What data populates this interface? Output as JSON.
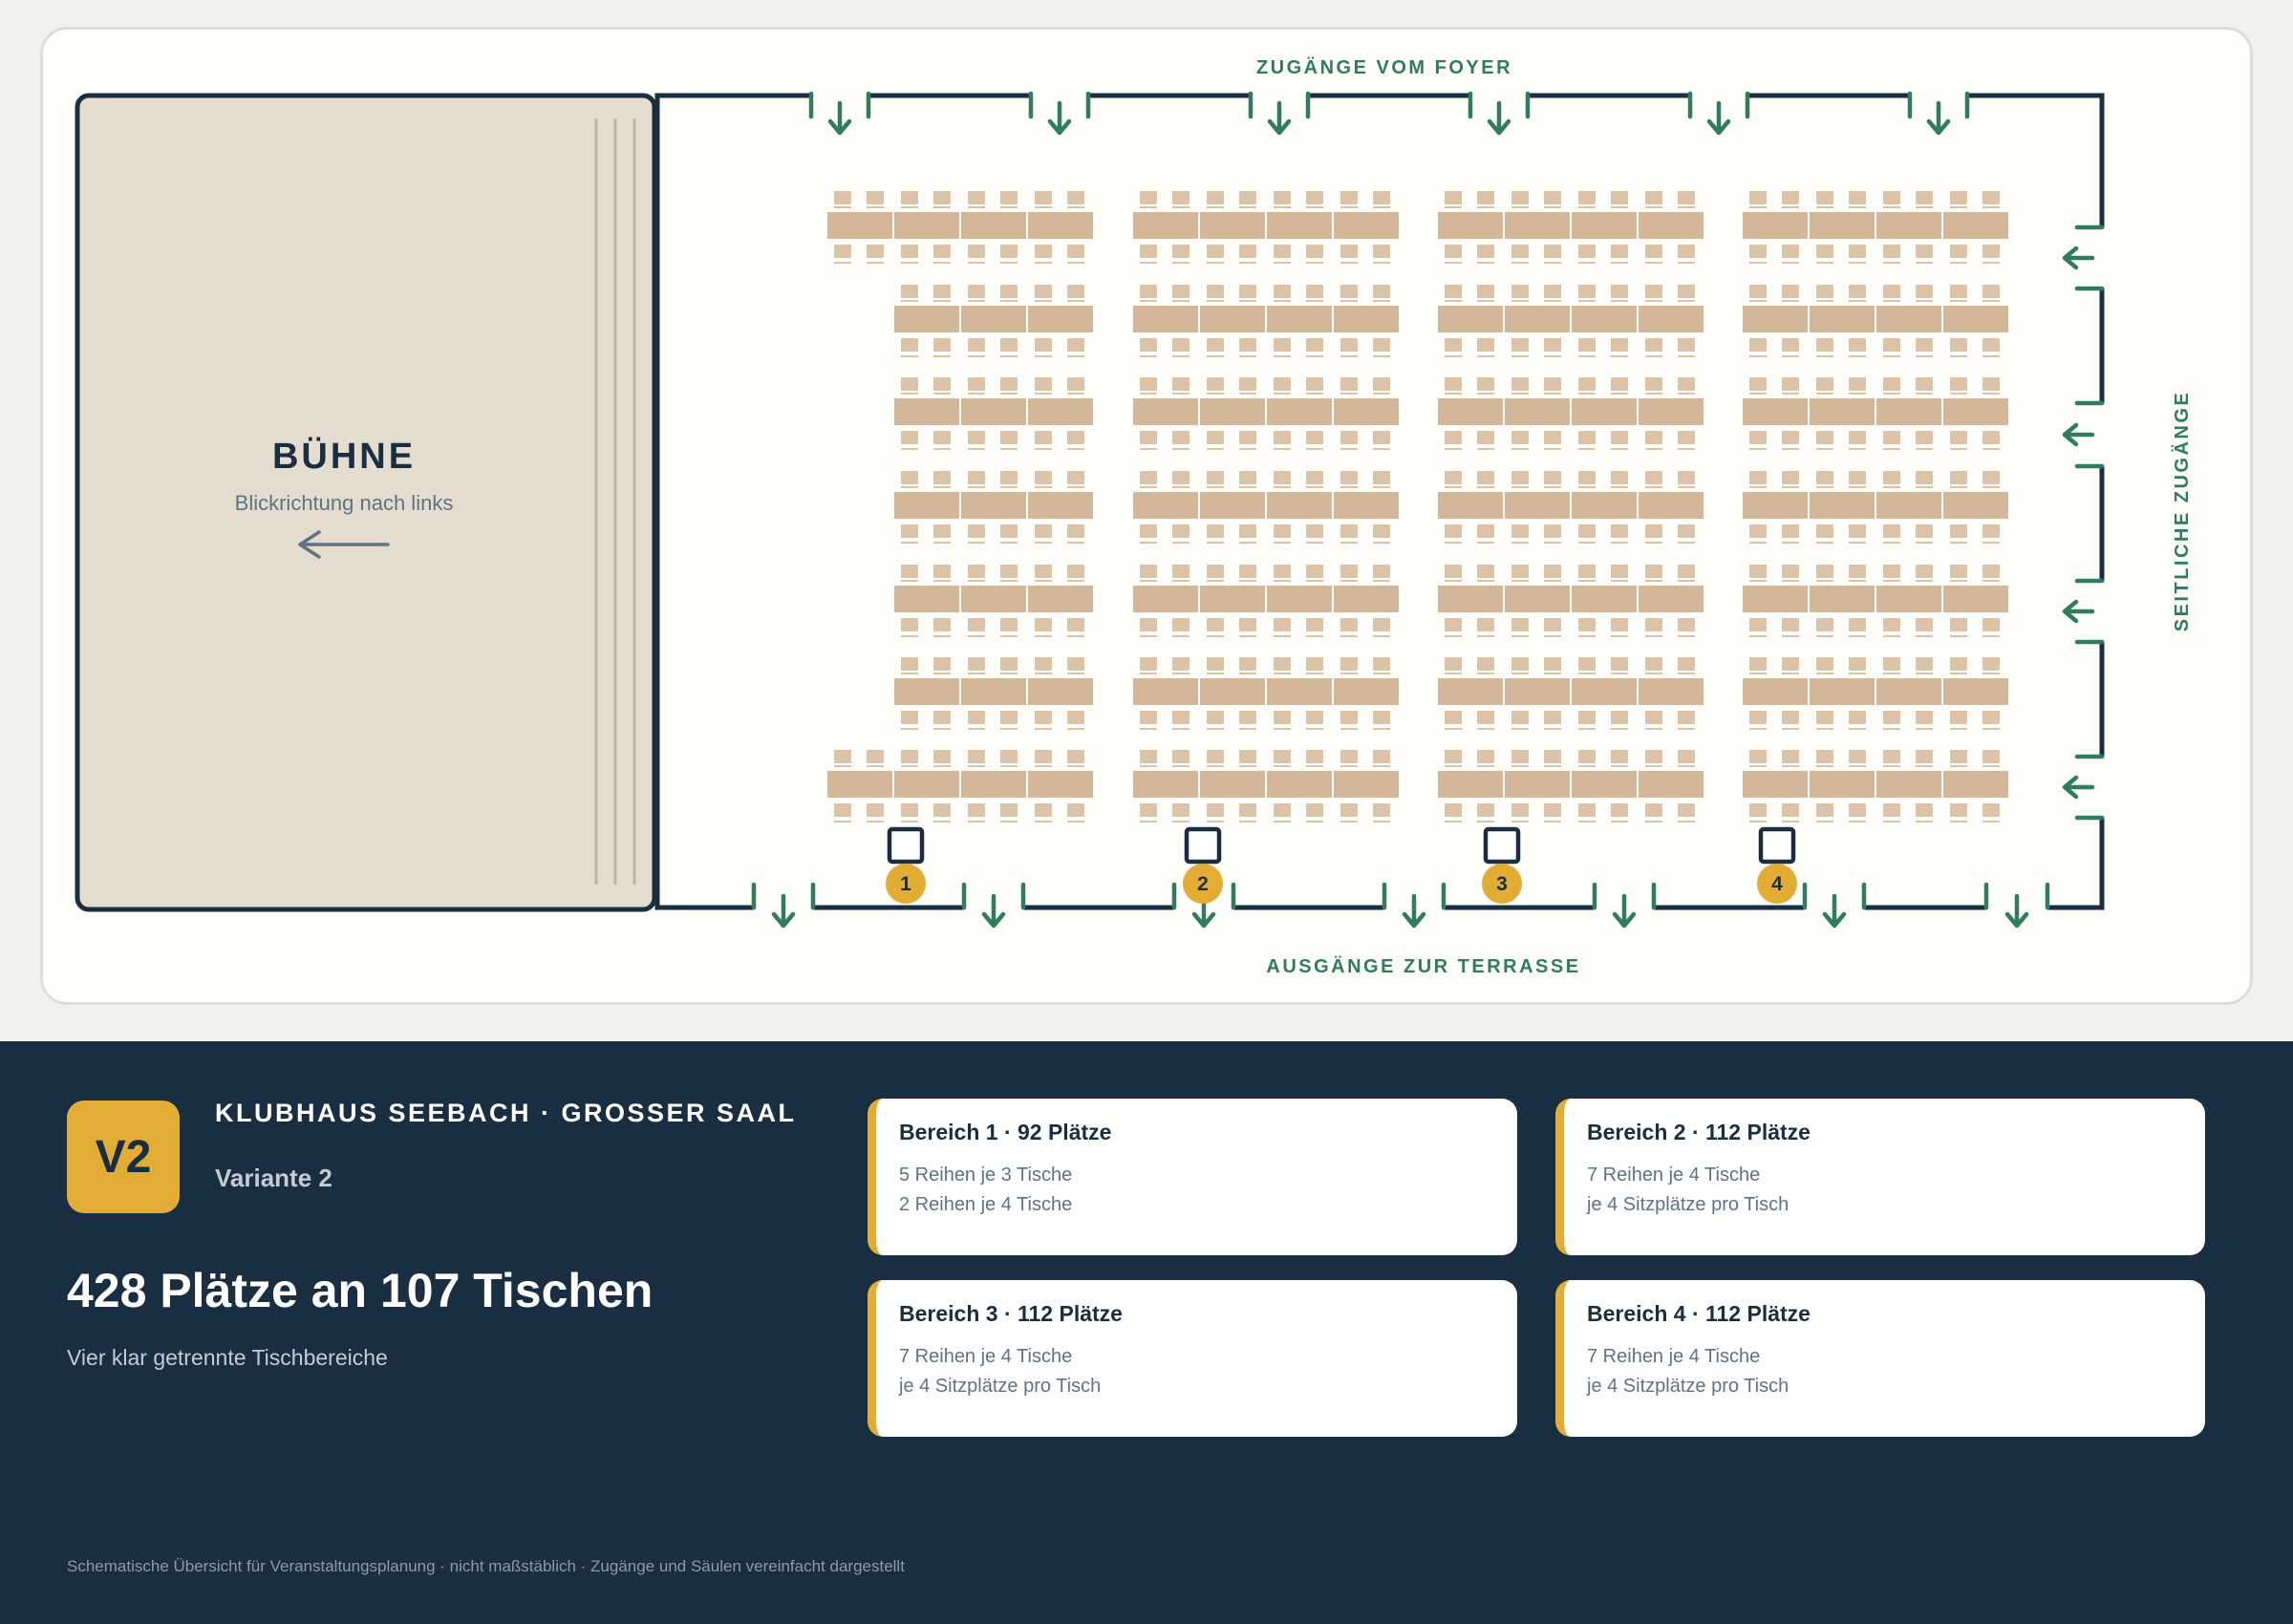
{
  "plan": {
    "top_label": "ZUGÄNGE VOM FOYER",
    "bottom_label": "AUSGÄNGE ZUR TERRASSE",
    "side_label": "SEITLICHE ZUGÄNGE",
    "stage": {
      "title": "BÜHNE",
      "subtitle": "Blickrichtung nach links"
    },
    "markers": [
      "1",
      "2",
      "3",
      "4"
    ]
  },
  "info": {
    "badge": "V2",
    "venue": "KLUBHAUS SEEBACH · GROSSER SAAL",
    "variant": "Variante 2",
    "headline": "428 Plätze an 107 Tischen",
    "subline": "Vier klar getrennte Tischbereiche",
    "areas": [
      {
        "title": "Bereich 1 · 92 Plätze",
        "line1": "5 Reihen je 3 Tische",
        "line2": "2 Reihen je 4 Tische"
      },
      {
        "title": "Bereich 2 · 112 Plätze",
        "line1": "7 Reihen je 4 Tische",
        "line2": "je 4 Sitzplätze pro Tisch"
      },
      {
        "title": "Bereich 3 · 112 Plätze",
        "line1": "7 Reihen je 4 Tische",
        "line2": "je 4 Sitzplätze pro Tisch"
      },
      {
        "title": "Bereich 4 · 112 Plätze",
        "line1": "7 Reihen je 4 Tische",
        "line2": "je 4 Sitzplätze pro Tisch"
      }
    ],
    "footnote": "Schematische Übersicht für Veranstaltungsplanung · nicht maßstäblich · Zugänge und Säulen vereinfacht dargestellt"
  },
  "layout": {
    "rows": 7,
    "areas": [
      {
        "tables_per_row": [
          4,
          3,
          3,
          3,
          3,
          3,
          4
        ]
      },
      {
        "tables_per_row": [
          4,
          4,
          4,
          4,
          4,
          4,
          4
        ]
      },
      {
        "tables_per_row": [
          4,
          4,
          4,
          4,
          4,
          4,
          4
        ]
      },
      {
        "tables_per_row": [
          4,
          4,
          4,
          4,
          4,
          4,
          4
        ]
      }
    ]
  },
  "colors": {
    "wall": "#1a2e42",
    "stage": "#e4dccf",
    "table": "#d4b699",
    "chair": "#dcc3a8",
    "access": "#2f7d5e",
    "accent": "#e2ac35",
    "panel": "#1a2e42"
  }
}
